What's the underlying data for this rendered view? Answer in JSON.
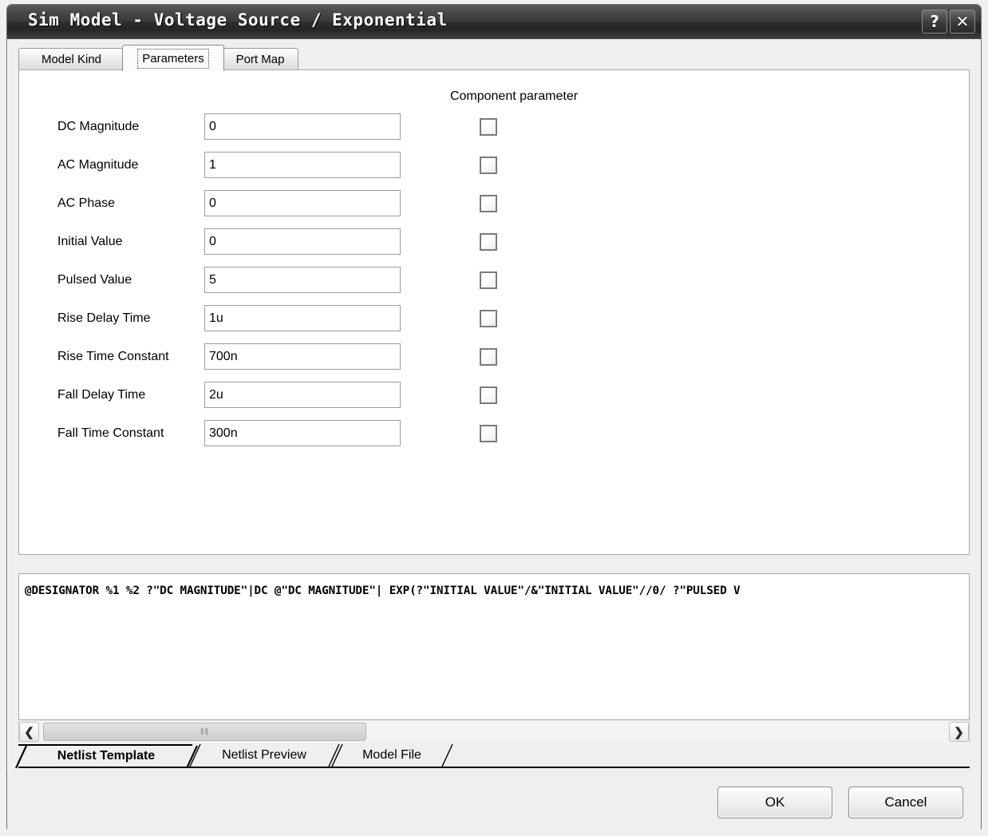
{
  "window": {
    "title": "Sim Model - Voltage Source / Exponential",
    "help_button": "?",
    "close_button": "✕"
  },
  "top_tabs": [
    {
      "label": "Model Kind",
      "active": false
    },
    {
      "label": "Parameters",
      "active": true
    },
    {
      "label": "Port Map",
      "active": false
    }
  ],
  "parameters_panel": {
    "component_parameter_header": "Component parameter",
    "rows": [
      {
        "label": "DC Magnitude",
        "value": "0",
        "checked": false
      },
      {
        "label": "AC Magnitude",
        "value": "1",
        "checked": false
      },
      {
        "label": "AC Phase",
        "value": "0",
        "checked": false
      },
      {
        "label": "Initial Value",
        "value": "0",
        "checked": false
      },
      {
        "label": "Pulsed Value",
        "value": "5",
        "checked": false
      },
      {
        "label": "Rise Delay Time",
        "value": "1u",
        "checked": false
      },
      {
        "label": "Rise Time Constant",
        "value": "700n",
        "checked": false
      },
      {
        "label": "Fall Delay Time",
        "value": "2u",
        "checked": false
      },
      {
        "label": "Fall Time Constant",
        "value": "300n",
        "checked": false
      }
    ]
  },
  "netlist": {
    "text": "@DESIGNATOR %1 %2 ?\"DC MAGNITUDE\"|DC @\"DC MAGNITUDE\"| EXP(?\"INITIAL VALUE\"/&\"INITIAL VALUE\"//0/ ?\"PULSED V"
  },
  "scrollbar": {
    "left_arrow": "❮",
    "right_arrow": "❯",
    "grip": "‖‖"
  },
  "bottom_tabs": [
    {
      "label": "Netlist Template",
      "active": true
    },
    {
      "label": "Netlist Preview",
      "active": false
    },
    {
      "label": "Model File",
      "active": false
    }
  ],
  "footer": {
    "ok_label": "OK",
    "cancel_label": "Cancel"
  },
  "colors": {
    "titlebar_dark": "#2e2e2e",
    "dialog_bg": "#efefef",
    "panel_bg": "#ffffff",
    "border": "#a6a6a6"
  }
}
